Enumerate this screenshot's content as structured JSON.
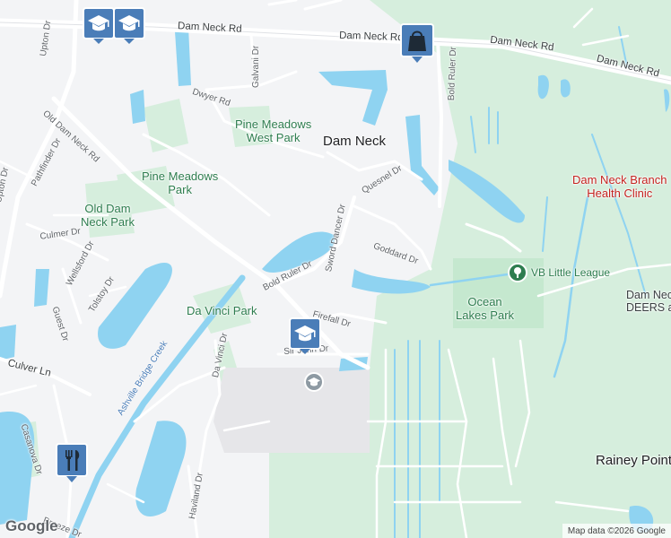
{
  "map": {
    "roads": {
      "dam_neck_rd": "Dam Neck Rd",
      "upton_dr": "Upton Dr",
      "old_dam_neck_rd": "Old Dam Neck Rd",
      "pathfinder_dr": "Pathfinder Dr",
      "dwyer_rd": "Dwyer Rd",
      "galvani_dr": "Galvani Dr",
      "bold_ruler_dr": "Bold Ruler Dr",
      "quesnel_dr": "Quesnel Dr",
      "sword_dancer_dr": "Sword Dancer Dr",
      "goddard_dr": "Goddard Dr",
      "culmer_dr": "Culmer Dr",
      "wellsford_dr": "Wellsford Dr",
      "tolstoy_dr": "Tolstoy Dr",
      "guest_dr": "Guest Dr",
      "firefall_dr": "Firefall Dr",
      "sir_john_dr": "Sir John Dr",
      "ashville_bridge_creek": "Ashville Bridge Creek",
      "da_vinci_dr": "Da Vinci Dr",
      "culver_ln": "Culver Ln",
      "casanova_dr": "Casanova Dr",
      "haviland_dr": "Haviland Dr",
      "breeze_dr": "Breeze Dr"
    },
    "places": {
      "pine_meadows_west_park": "Pine Meadows\nWest Park",
      "dam_neck": "Dam Neck",
      "pine_meadows_park": "Pine Meadows\nPark",
      "old_dam_neck_park": "Old Dam\nNeck Park",
      "da_vinci_park": "Da Vinci Park",
      "dam_neck_branch_health_clinic": "Dam Neck Branch\nHealth Clinic",
      "vb_little_league": "VB Little League",
      "dam_neck_deers": "Dam Neck\nDEERS and ID",
      "ocean_lakes_park": "Ocean\nLakes Park",
      "rainey_point": "Rainey Point"
    },
    "markers": [
      {
        "type": "school",
        "icon": "graduation-cap-icon"
      },
      {
        "type": "school",
        "icon": "graduation-cap-icon"
      },
      {
        "type": "shopping",
        "icon": "shopping-bag-icon"
      },
      {
        "type": "school",
        "icon": "graduation-cap-icon"
      },
      {
        "type": "restaurant",
        "icon": "fork-knife-icon"
      }
    ],
    "colors": {
      "land": "#f3f4f6",
      "green": "#d6eedd",
      "park_green": "#c5e8cf",
      "water": "#8fd3f1",
      "road": "#ffffff",
      "marker_blue": "#4a7db8",
      "marker_green": "#2e7d4f",
      "marker_grey": "#8e9aa3"
    }
  },
  "attribution": {
    "logo": "Google",
    "text": "Map data ©2026 Google"
  }
}
